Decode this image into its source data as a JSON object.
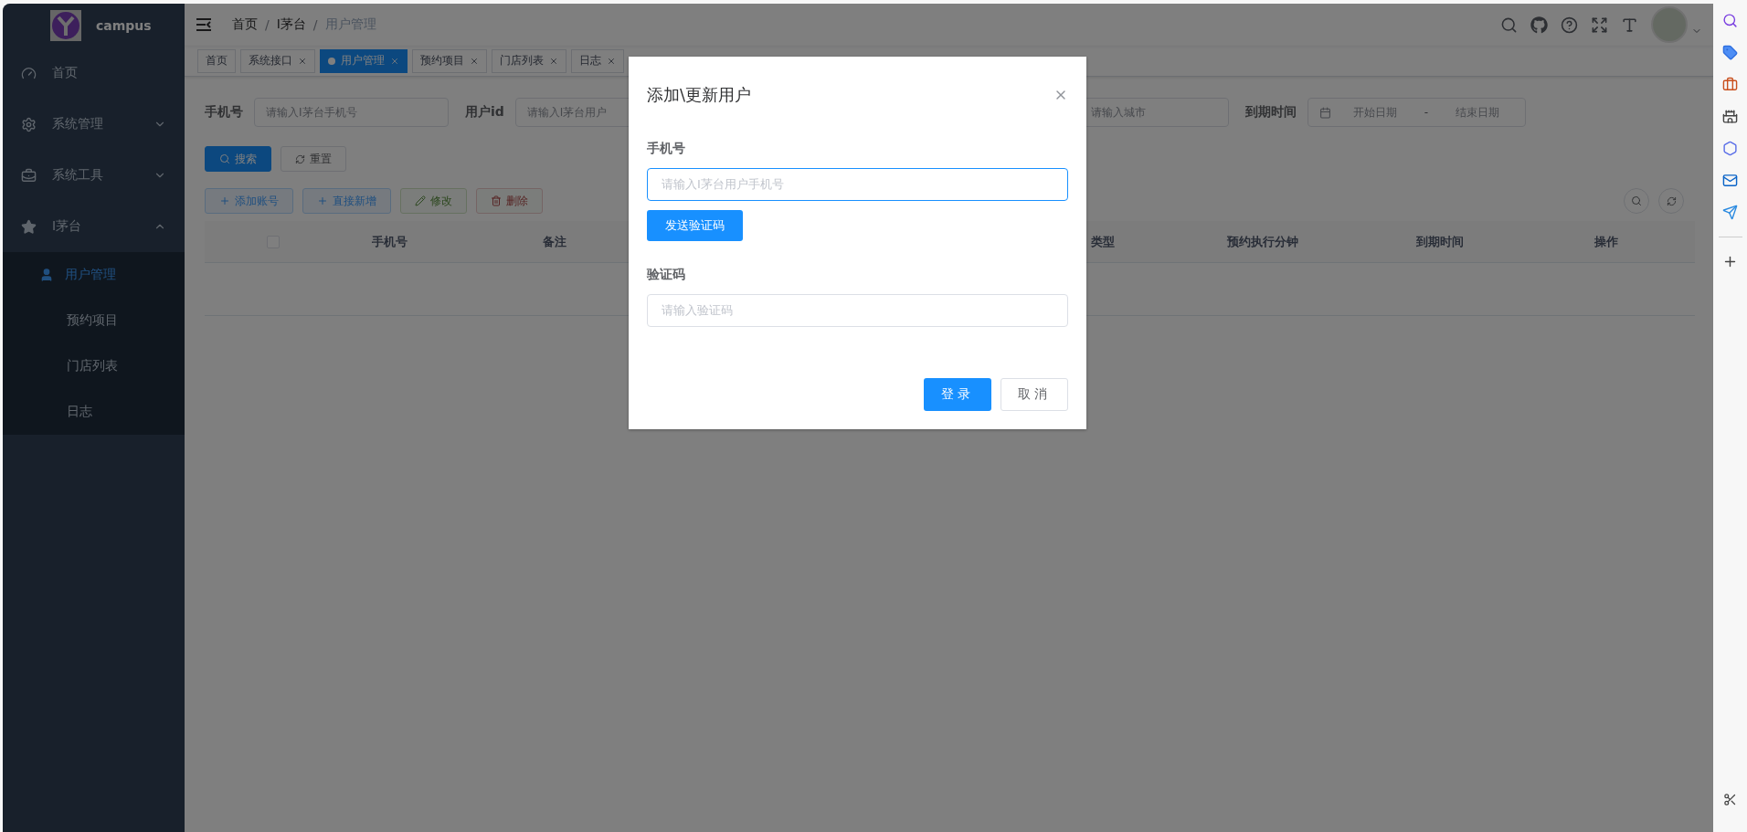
{
  "sidebar": {
    "logo_text": "campus",
    "items": [
      {
        "label": "首页",
        "kind": "link",
        "selected": false
      },
      {
        "label": "系统管理",
        "kind": "group",
        "expanded": false
      },
      {
        "label": "系统工具",
        "kind": "group",
        "expanded": false
      },
      {
        "label": "I茅台",
        "kind": "group",
        "expanded": true,
        "children": [
          {
            "label": "用户管理",
            "selected": true
          },
          {
            "label": "预约项目",
            "selected": false
          },
          {
            "label": "门店列表",
            "selected": false
          },
          {
            "label": "日志",
            "selected": false
          }
        ]
      }
    ]
  },
  "breadcrumbs": [
    {
      "label": "首页",
      "current": false
    },
    {
      "separator": "/",
      "label": "I茅台",
      "current": false
    },
    {
      "separator": "/",
      "label": "用户管理",
      "current": true
    }
  ],
  "tags": [
    {
      "label": "首页",
      "selected": false,
      "closable": false
    },
    {
      "label": "系统接口",
      "selected": false,
      "closable": true
    },
    {
      "label": "用户管理",
      "selected": true,
      "closable": true
    },
    {
      "label": "预约项目",
      "selected": false,
      "closable": true
    },
    {
      "label": "门店列表",
      "selected": false,
      "closable": true
    },
    {
      "label": "日志",
      "selected": false,
      "closable": true
    }
  ],
  "filters": [
    {
      "kind": "text",
      "label": "手机号",
      "placeholder": "请输入I茅台手机号"
    },
    {
      "kind": "text",
      "label": "用户id",
      "placeholder": "请输入I茅台用户"
    },
    {
      "kind": "text",
      "placeholder": "请输入城市"
    },
    {
      "kind": "daterange",
      "label": "到期时间",
      "start_placeholder": "开始日期",
      "separator": "-",
      "end_placeholder": "结束日期"
    }
  ],
  "search_buttons": [
    {
      "label": "搜索",
      "kind": "primary"
    },
    {
      "label": "重置",
      "kind": "default"
    }
  ],
  "action_buttons": [
    {
      "label": "添加账号",
      "kind": "primary",
      "disabled": false
    },
    {
      "label": "直接新增",
      "kind": "primary",
      "disabled": false
    },
    {
      "label": "修改",
      "kind": "success",
      "disabled": true
    },
    {
      "label": "删除",
      "kind": "danger",
      "disabled": true
    }
  ],
  "table": {
    "select_all": {
      "checked": false
    },
    "columns": [
      "手机号",
      "备注",
      "类型",
      "预约执行分钟",
      "到期时间",
      "操作"
    ]
  },
  "dialog": {
    "title": "添加\\更新用户",
    "fields": [
      {
        "label": "手机号",
        "placeholder": "请输入I茅台用户手机号",
        "focused": true
      },
      {
        "label": "验证码",
        "placeholder": "请输入验证码",
        "focused": false
      }
    ],
    "send_button": "发送验证码",
    "buttons": [
      {
        "label": "登录",
        "kind": "primary"
      },
      {
        "label": "取消",
        "kind": "default"
      }
    ]
  }
}
